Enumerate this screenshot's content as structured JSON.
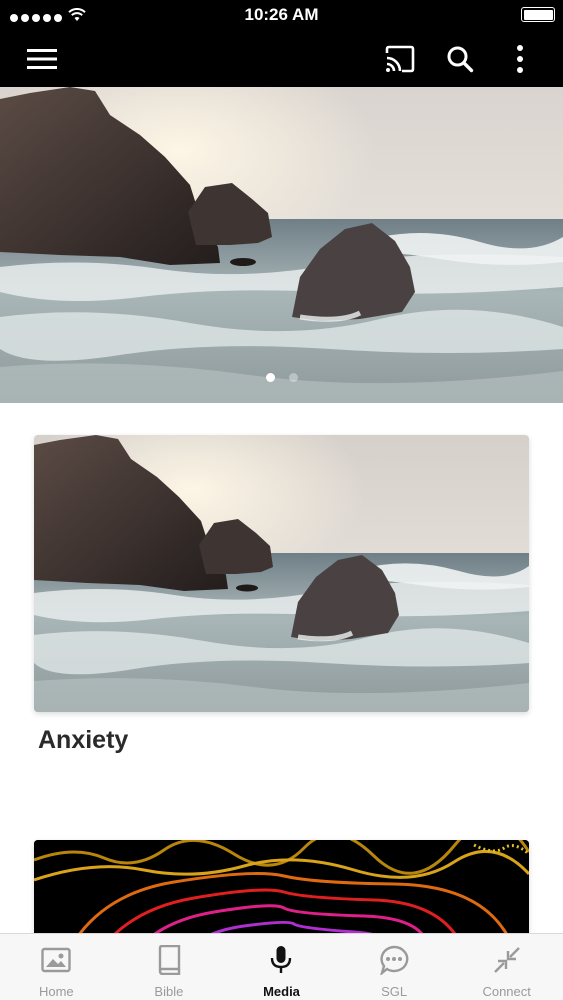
{
  "status_bar": {
    "time": "10:26 AM",
    "signal_icon": "signal-dots-icon",
    "wifi_icon": "wifi-icon",
    "battery_icon": "battery-icon"
  },
  "app_bar": {
    "menu_icon": "hamburger-menu-icon",
    "cast_icon": "cast-icon",
    "search_icon": "search-icon",
    "more_icon": "more-vertical-icon"
  },
  "hero": {
    "pager": {
      "count": 2,
      "active": 1
    }
  },
  "cards": [
    {
      "title": "Anxiety"
    },
    {
      "title": ""
    }
  ],
  "tab_bar": {
    "active": "Media",
    "tabs": [
      {
        "label": "Home",
        "icon": "image-icon"
      },
      {
        "label": "Bible",
        "icon": "book-icon"
      },
      {
        "label": "Media",
        "icon": "microphone-icon"
      },
      {
        "label": "SGL",
        "icon": "chat-bubble-icon"
      },
      {
        "label": "Connect",
        "icon": "collapse-arrows-icon"
      }
    ]
  },
  "colors": {
    "bar_background": "#000000",
    "tab_inactive": "#9a9a9a",
    "tab_active": "#111111",
    "title_text": "#2a2a2a"
  }
}
